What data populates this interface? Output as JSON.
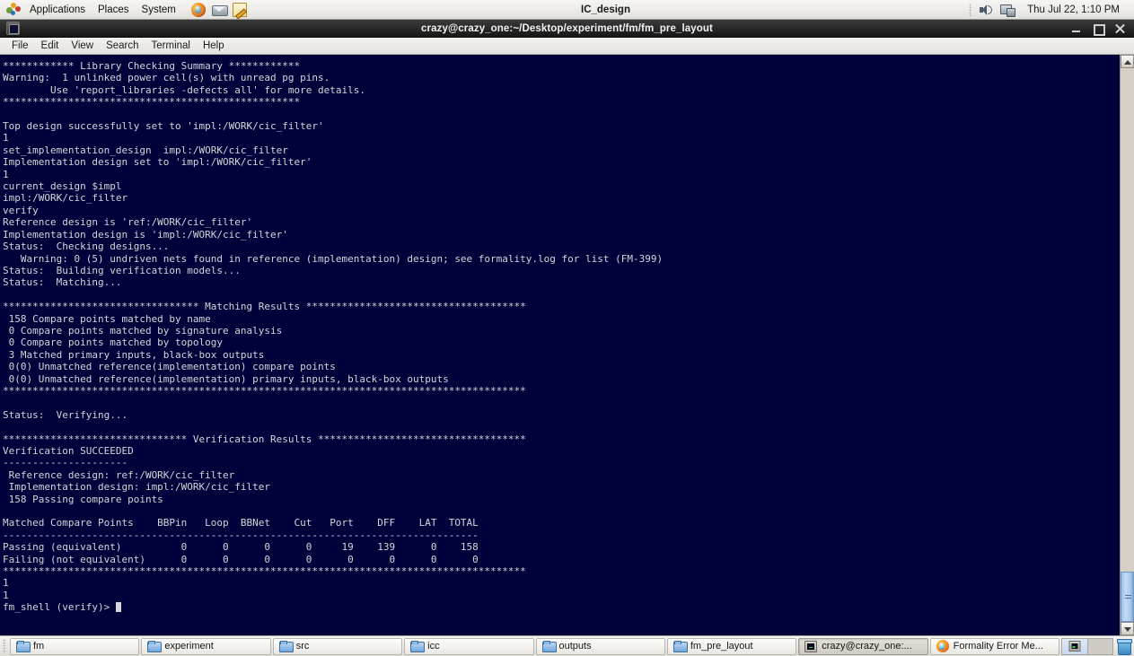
{
  "top_panel": {
    "menus": [
      "Applications",
      "Places",
      "System"
    ],
    "foot_icon": "gnome-foot-icon",
    "launchers": [
      {
        "name": "firefox-icon",
        "label": "Firefox"
      },
      {
        "name": "mail-icon",
        "label": "Evolution Mail"
      },
      {
        "name": "text-editor-icon",
        "label": "Text Editor"
      }
    ],
    "window_title": "IC_design",
    "tray": [
      {
        "name": "volume-icon"
      },
      {
        "name": "network-icon"
      }
    ],
    "clock": "Thu Jul 22,  1:10 PM"
  },
  "window": {
    "title": "crazy@crazy_one:~/Desktop/experiment/fm/fm_pre_layout",
    "icon": "terminal-icon",
    "buttons": {
      "minimize": "minimize-icon",
      "maximize": "maximize-icon",
      "close": "close-icon"
    },
    "menubar": [
      "File",
      "Edit",
      "View",
      "Search",
      "Terminal",
      "Help"
    ]
  },
  "terminal": {
    "colors": {
      "background": "#00003b",
      "foreground": "#d6d6d6"
    },
    "prompt": "fm_shell (verify)> ",
    "cursor": "block-cursor",
    "lines": [
      "************ Library Checking Summary ************",
      "Warning:  1 unlinked power cell(s) with unread pg pins.",
      "        Use 'report_libraries -defects all' for more details.",
      "**************************************************",
      "",
      "Top design successfully set to 'impl:/WORK/cic_filter'",
      "1",
      "set_implementation_design  impl:/WORK/cic_filter",
      "Implementation design set to 'impl:/WORK/cic_filter'",
      "1",
      "current_design $impl",
      "impl:/WORK/cic_filter",
      "verify",
      "Reference design is 'ref:/WORK/cic_filter'",
      "Implementation design is 'impl:/WORK/cic_filter'",
      "Status:  Checking designs...",
      "   Warning: 0 (5) undriven nets found in reference (implementation) design; see formality.log for list (FM-399)",
      "Status:  Building verification models...",
      "Status:  Matching...",
      "",
      "********************************* Matching Results *************************************",
      " 158 Compare points matched by name",
      " 0 Compare points matched by signature analysis",
      " 0 Compare points matched by topology",
      " 3 Matched primary inputs, black-box outputs",
      " 0(0) Unmatched reference(implementation) compare points",
      " 0(0) Unmatched reference(implementation) primary inputs, black-box outputs",
      "****************************************************************************************",
      "",
      "Status:  Verifying...",
      "",
      "******************************* Verification Results ***********************************",
      "Verification SUCCEEDED",
      "---------------------",
      " Reference design: ref:/WORK/cic_filter",
      " Implementation design: impl:/WORK/cic_filter",
      " 158 Passing compare points",
      "",
      "Matched Compare Points    BBPin   Loop  BBNet    Cut   Port    DFF    LAT  TOTAL",
      "--------------------------------------------------------------------------------",
      "Passing (equivalent)          0      0      0      0     19    139      0    158",
      "Failing (not equivalent)      0      0      0      0      0      0      0      0",
      "****************************************************************************************",
      "1",
      "1"
    ],
    "results_table": {
      "header": [
        "Matched Compare Points",
        "BBPin",
        "Loop",
        "BBNet",
        "Cut",
        "Port",
        "DFF",
        "LAT",
        "TOTAL"
      ],
      "rows": [
        {
          "label": "Passing (equivalent)",
          "values": [
            0,
            0,
            0,
            0,
            19,
            139,
            0,
            158
          ]
        },
        {
          "label": "Failing (not equivalent)",
          "values": [
            0,
            0,
            0,
            0,
            0,
            0,
            0,
            0
          ]
        }
      ]
    },
    "scrollbar": {
      "up_arrow": "scroll-up-icon",
      "down_arrow": "scroll-down-icon",
      "thumb": "scroll-thumb"
    }
  },
  "taskbar": {
    "items": [
      {
        "label": "fm",
        "icon": "folder-icon",
        "active": false
      },
      {
        "label": "experiment",
        "icon": "folder-icon",
        "active": false
      },
      {
        "label": "src",
        "icon": "folder-icon",
        "active": false
      },
      {
        "label": "icc",
        "icon": "folder-icon",
        "active": false
      },
      {
        "label": "outputs",
        "icon": "folder-icon",
        "active": false
      },
      {
        "label": "fm_pre_layout",
        "icon": "folder-icon",
        "active": false
      },
      {
        "label": "crazy@crazy_one:...",
        "icon": "terminal-icon",
        "active": true
      },
      {
        "label": "Formality Error Me...",
        "icon": "firefox-icon",
        "active": false
      }
    ],
    "workspaces": [
      {
        "name": "workspace-1",
        "active": true
      },
      {
        "name": "workspace-2",
        "active": false
      }
    ],
    "trash": "trash-icon"
  }
}
